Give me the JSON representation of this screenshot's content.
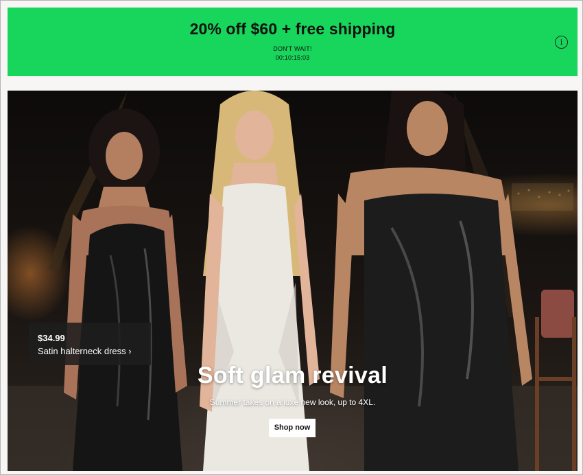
{
  "promo": {
    "title": "20% off $60 + free shipping",
    "urgency_label": "DON'T WAIT!",
    "countdown": "00:10:15:03",
    "info_icon": "info-icon",
    "info_glyph": "i",
    "background_color": "#18d65b"
  },
  "hero": {
    "image_alt": "Three models wearing satin and knit dresses at night",
    "product_tag": {
      "price": "$34.99",
      "name": "Satin halterneck dress",
      "chevron": "›"
    },
    "title": "Soft glam revival",
    "subtitle": "Summer takes on a luxe new look, up to 4XL.",
    "cta_label": "Shop now"
  }
}
